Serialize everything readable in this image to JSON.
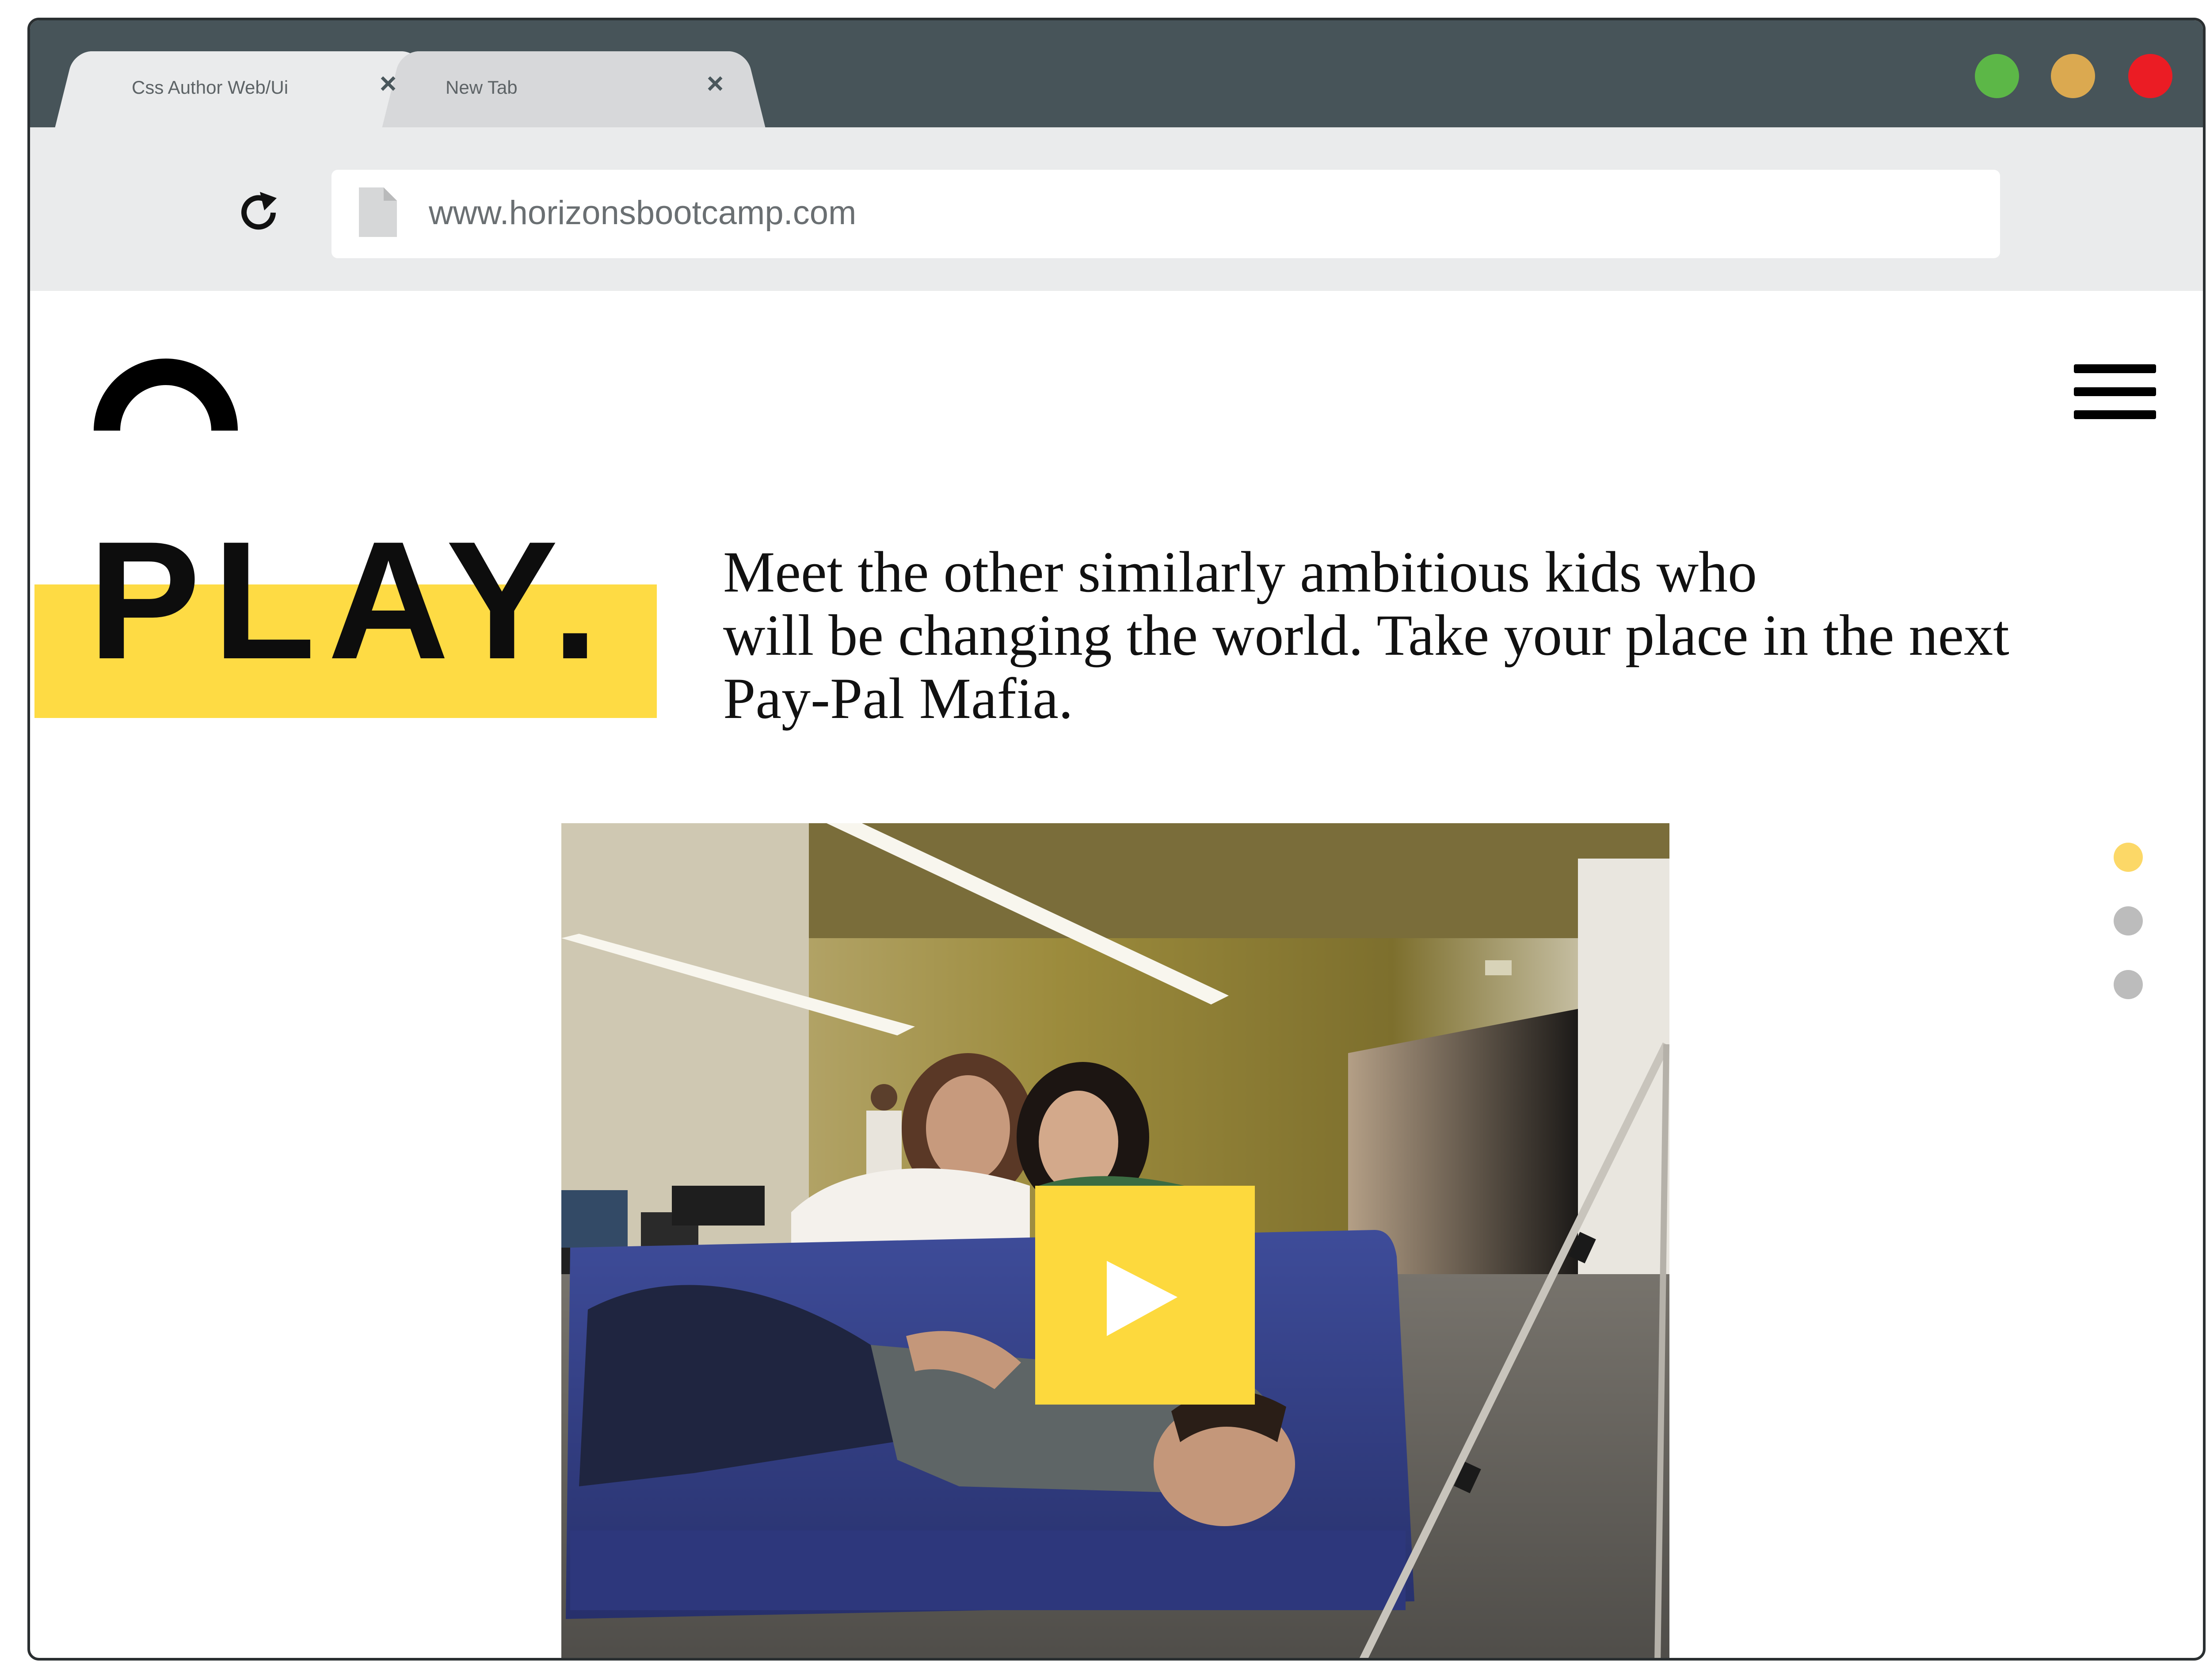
{
  "browser": {
    "tabs": [
      {
        "title": "Css Author   Web/Ui",
        "close": "×",
        "active": true
      },
      {
        "title": "New Tab",
        "close": "×",
        "active": false
      }
    ],
    "window_controls": [
      "green-dot",
      "yellow-dot",
      "red-dot"
    ],
    "address": {
      "url": "www.horizonsbootcamp.com",
      "reload_icon": "reload-icon",
      "page_icon": "document-icon"
    }
  },
  "page": {
    "logo_icon": "arch-logo-icon",
    "menu_icon": "hamburger-menu-icon",
    "heading": "PLAY.",
    "blurb": {
      "line1": "Meet the other similarly ambitious kids who",
      "line2": "will be changing the world. Take your place in the next",
      "line3": "Pay-Pal Mafia."
    },
    "video": {
      "thumbnail": "Three people relaxing on a blue couch in an office",
      "play_icon": "play-icon"
    },
    "pagination": {
      "count": 3,
      "active_index": 0
    }
  },
  "colors": {
    "tabbar": "#475459",
    "toolbar": "#eaebec",
    "accent_yellow": "#fedb44",
    "dot_active": "#fcd867",
    "dot_inactive": "#bcbcbc",
    "green": "#5cb747",
    "yellow": "#dba950",
    "red": "#eb1c24"
  }
}
